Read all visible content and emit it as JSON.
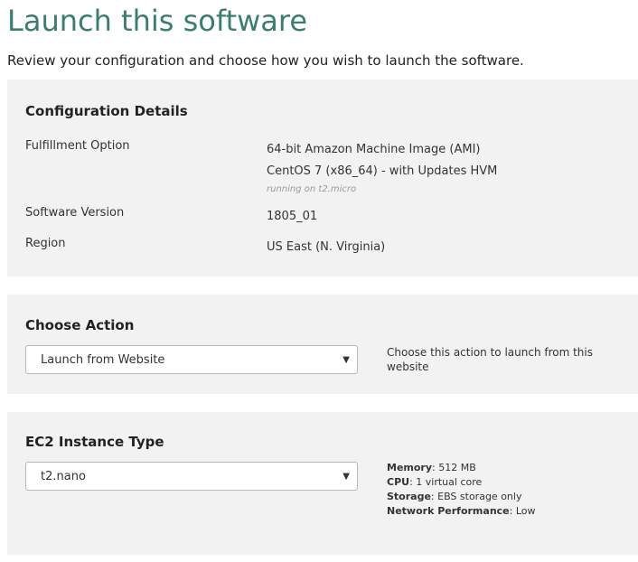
{
  "header": {
    "title": "Launch this software",
    "subtitle": "Review your configuration and choose how you wish to launch the software."
  },
  "configuration": {
    "heading": "Configuration Details",
    "fulfillment_label": "Fulfillment Option",
    "fulfillment_value_line1": "64-bit Amazon Machine Image (AMI)",
    "fulfillment_value_line2": "CentOS 7 (x86_64) - with Updates HVM",
    "fulfillment_note": "running on t2.micro",
    "version_label": "Software Version",
    "version_value": "1805_01",
    "region_label": "Region",
    "region_value": "US East (N. Virginia)"
  },
  "action": {
    "heading": "Choose Action",
    "selected": "Launch from Website",
    "help": "Choose this action to launch from this website"
  },
  "instance": {
    "heading": "EC2 Instance Type",
    "selected": "t2.nano",
    "specs": [
      {
        "key": "Memory",
        "value": "512 MB"
      },
      {
        "key": "CPU",
        "value": "1 virtual core"
      },
      {
        "key": "Storage",
        "value": "EBS storage only"
      },
      {
        "key": "Network Performance",
        "value": "Low"
      }
    ]
  },
  "icons": {
    "dropdown_arrow": "▼"
  },
  "colors": {
    "title": "#3b7d6e",
    "panel_bg": "#f2f2f2"
  }
}
